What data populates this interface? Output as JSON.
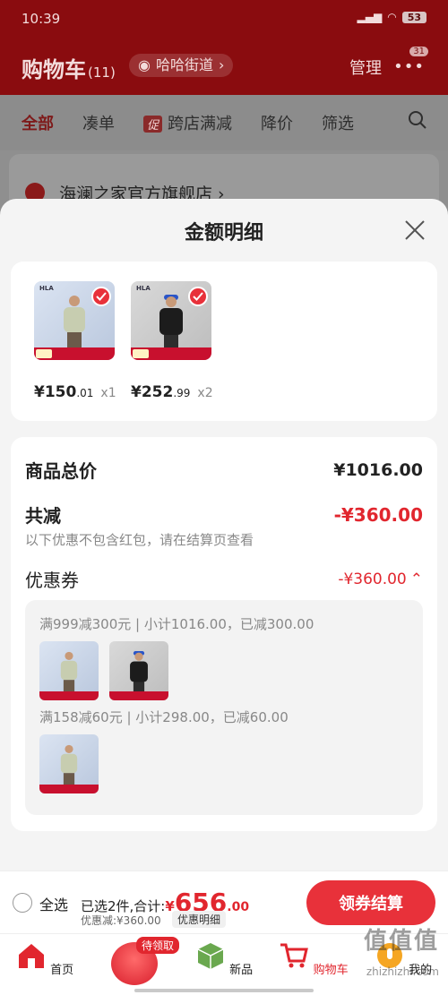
{
  "status_bar": {
    "time": "10:39",
    "battery": "53"
  },
  "header": {
    "title": "购物车",
    "count": "(11)",
    "street": "哈哈街道",
    "manage": "管理",
    "more_badge": "31"
  },
  "filter_tabs": [
    {
      "label": "全部"
    },
    {
      "label": "凑单"
    },
    {
      "label": "跨店满减",
      "tag": "促"
    },
    {
      "label": "降价"
    },
    {
      "label": "筛选"
    }
  ],
  "store": {
    "name": "海澜之家官方旗舰店 ›"
  },
  "modal": {
    "title": "金额明细",
    "products": [
      {
        "price_int": "¥150",
        "price_dec": ".01",
        "qty": "x1",
        "style": "light"
      },
      {
        "price_int": "¥252",
        "price_dec": ".99",
        "qty": "x2",
        "style": "dark"
      }
    ],
    "goods_total_label": "商品总价",
    "goods_total_value": "¥1016.00",
    "discount_label": "共减",
    "discount_value": "-¥360.00",
    "discount_note": "以下优惠不包含红包，请在结算页查看",
    "coupon_label": "优惠券",
    "coupon_value": "-¥360.00",
    "rules": [
      {
        "text": "满999减300元 | 小计1016.00，已减300.00"
      },
      {
        "text": "满158减60元 | 小计298.00，已减60.00"
      }
    ]
  },
  "checkout": {
    "select_all": "全选",
    "selected_text": "已选2件,合计:",
    "total_yen": "¥",
    "total_int": "656",
    "total_dec": ".00",
    "discount_text": "优惠减:¥360.00",
    "detail_chip": "优惠明细",
    "pay_button": "领券结算"
  },
  "nav": [
    {
      "label": "首页"
    },
    {
      "label": ""
    },
    {
      "label": "新品"
    },
    {
      "label": "购物车"
    },
    {
      "label": "我的"
    }
  ],
  "nav_pending_badge": "待领取",
  "watermark": {
    "text": "值值值",
    "url": "zhizhizhi.com"
  },
  "colors": {
    "accent": "#e1262e",
    "header_bg": "#8a0c0f"
  }
}
